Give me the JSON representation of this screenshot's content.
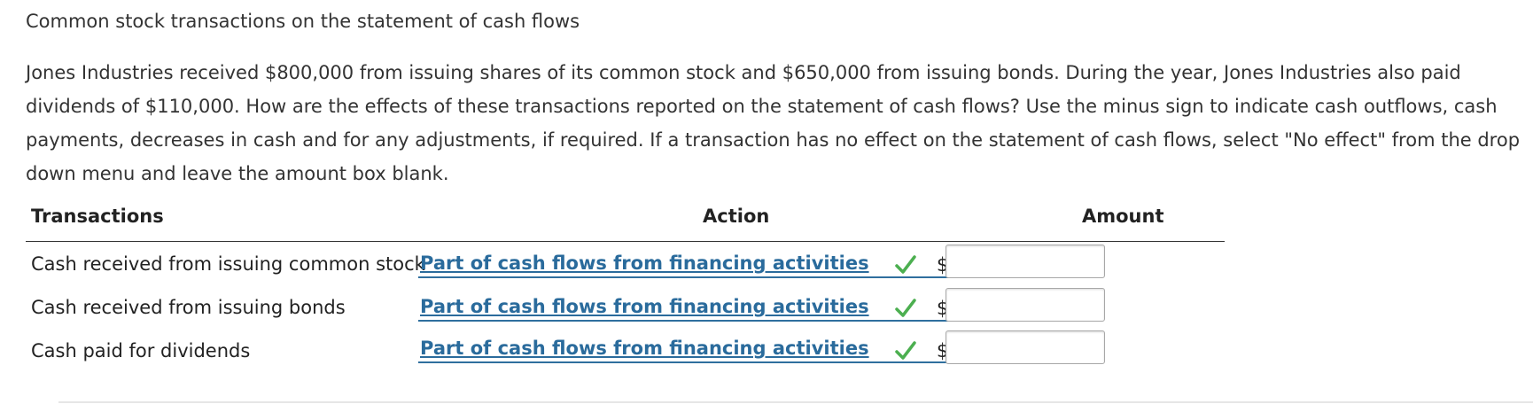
{
  "problem": {
    "title": "Common stock transactions on the statement of cash flows",
    "instructions": "Jones Industries received $800,000 from issuing shares of its common stock and $650,000 from issuing bonds. During the year, Jones Industries also paid dividends of $110,000. How are the effects of these transactions reported on the statement of cash flows? Use the minus sign to indicate cash outflows, cash payments, decreases in cash and for any adjustments, if required. If a transaction has no effect on the statement of cash flows, select \"No effect\" from the drop down menu and leave the amount box blank."
  },
  "table": {
    "headers": {
      "transactions": "Transactions",
      "action": "Action",
      "amount": "Amount"
    },
    "rows": [
      {
        "label": "Cash received from issuing common stock",
        "action": "Part of cash flows from financing activities",
        "status": "correct",
        "currency": "$",
        "amount": ""
      },
      {
        "label": "Cash received from issuing bonds",
        "action": "Part of cash flows from financing activities",
        "status": "correct",
        "currency": "$",
        "amount": ""
      },
      {
        "label": "Cash paid for dividends",
        "action": "Part of cash flows from financing activities",
        "status": "correct",
        "currency": "$",
        "amount": ""
      }
    ]
  },
  "colors": {
    "link_blue": "#2a6b9c",
    "check_green": "#4caf50",
    "text": "#333333"
  },
  "icons": {
    "check": "check-icon",
    "dropdown": "chevron-down-icon"
  }
}
